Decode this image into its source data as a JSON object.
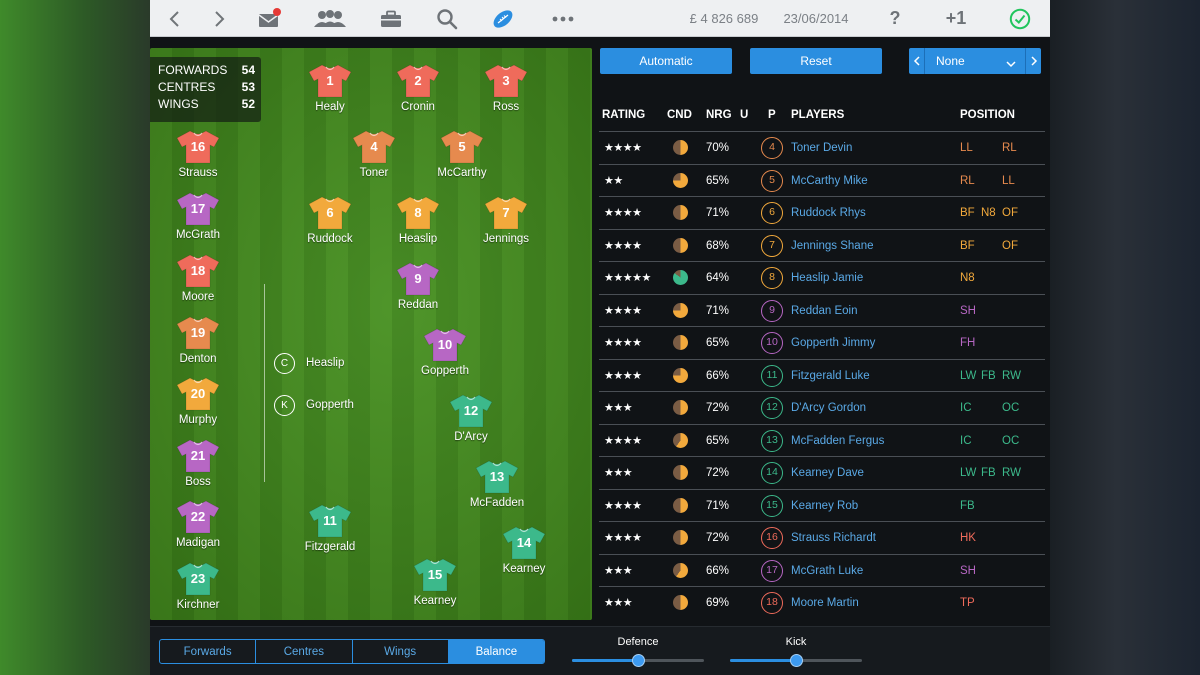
{
  "topbar": {
    "money": "£ 4 826 689",
    "date": "23/06/2014",
    "help_label": "?",
    "plus_label": "+1"
  },
  "pitch": {
    "unit_ratings": [
      {
        "label": "FORWARDS",
        "value": "54"
      },
      {
        "label": "CENTRES",
        "value": "53"
      },
      {
        "label": "WINGS",
        "value": "52"
      }
    ],
    "players": [
      {
        "num": "1",
        "name": "Healy",
        "color": "#ef6b5b"
      },
      {
        "num": "2",
        "name": "Cronin",
        "color": "#ef6b5b"
      },
      {
        "num": "3",
        "name": "Ross",
        "color": "#ef6b5b"
      },
      {
        "num": "4",
        "name": "Toner",
        "color": "#e68a4e"
      },
      {
        "num": "5",
        "name": "McCarthy",
        "color": "#e68a4e"
      },
      {
        "num": "6",
        "name": "Ruddock",
        "color": "#f2a93c"
      },
      {
        "num": "8",
        "name": "Heaslip",
        "color": "#f2a93c"
      },
      {
        "num": "7",
        "name": "Jennings",
        "color": "#f2a93c"
      },
      {
        "num": "9",
        "name": "Reddan",
        "color": "#b767c4"
      },
      {
        "num": "10",
        "name": "Gopperth",
        "color": "#b767c4"
      },
      {
        "num": "12",
        "name": "D'Arcy",
        "color": "#3cb98b"
      },
      {
        "num": "13",
        "name": "McFadden",
        "color": "#3cb98b"
      },
      {
        "num": "11",
        "name": "Fitzgerald",
        "color": "#3cb98b"
      },
      {
        "num": "14",
        "name": "Kearney",
        "color": "#3cb98b"
      },
      {
        "num": "15",
        "name": "Kearney",
        "color": "#3cb98b"
      }
    ],
    "bench": [
      {
        "num": "16",
        "name": "Strauss",
        "color": "#ef6b5b"
      },
      {
        "num": "17",
        "name": "McGrath",
        "color": "#b767c4"
      },
      {
        "num": "18",
        "name": "Moore",
        "color": "#ef6b5b"
      },
      {
        "num": "19",
        "name": "Denton",
        "color": "#e68a4e"
      },
      {
        "num": "20",
        "name": "Murphy",
        "color": "#f2a93c"
      },
      {
        "num": "21",
        "name": "Boss",
        "color": "#b767c4"
      },
      {
        "num": "22",
        "name": "Madigan",
        "color": "#b767c4"
      },
      {
        "num": "23",
        "name": "Kirchner",
        "color": "#3cb98b"
      }
    ],
    "roles": [
      {
        "letter": "C",
        "name": "Heaslip"
      },
      {
        "letter": "K",
        "name": "Gopperth"
      }
    ]
  },
  "controls": {
    "automatic_label": "Automatic",
    "reset_label": "Reset",
    "select_value": "None"
  },
  "table": {
    "headers": {
      "rating": "RATING",
      "cnd": "CND",
      "nrg": "NRG",
      "u": "U",
      "p": "P",
      "players": "PLAYERS",
      "position": "POSITION"
    },
    "rows": [
      {
        "stars": 4,
        "cnd": 0.5,
        "nrg": "70%",
        "num": "4",
        "num_color": "#e68a4e",
        "name": "Toner Devin",
        "positions": [
          {
            "p": "LL",
            "c": "#e68a4e"
          },
          {
            "p": "RL",
            "c": "#e68a4e"
          }
        ]
      },
      {
        "stars": 2,
        "cnd": 0.75,
        "nrg": "65%",
        "num": "5",
        "num_color": "#e68a4e",
        "name": "McCarthy Mike",
        "positions": [
          {
            "p": "RL",
            "c": "#e68a4e"
          },
          {
            "p": "LL",
            "c": "#e68a4e"
          }
        ]
      },
      {
        "stars": 4,
        "cnd": 0.5,
        "nrg": "71%",
        "num": "6",
        "num_color": "#f2a93c",
        "name": "Ruddock Rhys",
        "positions": [
          {
            "p": "BF",
            "c": "#f2a93c"
          },
          {
            "p": "N8",
            "c": "#f2a93c"
          },
          {
            "p": "OF",
            "c": "#f2a93c"
          }
        ]
      },
      {
        "stars": 4,
        "cnd": 0.5,
        "nrg": "68%",
        "num": "7",
        "num_color": "#f2a93c",
        "name": "Jennings Shane",
        "positions": [
          {
            "p": "BF",
            "c": "#f2a93c"
          },
          {
            "p": "OF",
            "c": "#f2a93c"
          }
        ]
      },
      {
        "stars": 5,
        "cnd": 0.85,
        "nrg": "64%",
        "num": "8",
        "num_color": "#f2a93c",
        "name": "Heaslip Jamie",
        "positions": [
          {
            "p": "N8",
            "c": "#f2a93c"
          }
        ]
      },
      {
        "stars": 4,
        "cnd": 0.75,
        "nrg": "71%",
        "num": "9",
        "num_color": "#b767c4",
        "name": "Reddan Eoin",
        "positions": [
          {
            "p": "SH",
            "c": "#b767c4"
          }
        ]
      },
      {
        "stars": 4,
        "cnd": 0.5,
        "nrg": "65%",
        "num": "10",
        "num_color": "#b767c4",
        "name": "Gopperth Jimmy",
        "positions": [
          {
            "p": "FH",
            "c": "#b767c4"
          }
        ]
      },
      {
        "stars": 4,
        "cnd": 0.75,
        "nrg": "66%",
        "num": "11",
        "num_color": "#3cb98b",
        "name": "Fitzgerald Luke",
        "positions": [
          {
            "p": "LW",
            "c": "#3cb98b"
          },
          {
            "p": "FB",
            "c": "#3cb98b"
          },
          {
            "p": "RW",
            "c": "#3cb98b"
          }
        ]
      },
      {
        "stars": 3,
        "cnd": 0.5,
        "nrg": "72%",
        "num": "12",
        "num_color": "#3cb98b",
        "name": "D'Arcy Gordon",
        "positions": [
          {
            "p": "IC",
            "c": "#3cb98b"
          },
          {
            "p": "OC",
            "c": "#3cb98b"
          }
        ]
      },
      {
        "stars": 4,
        "cnd": 0.6,
        "nrg": "65%",
        "num": "13",
        "num_color": "#3cb98b",
        "name": "McFadden Fergus",
        "positions": [
          {
            "p": "IC",
            "c": "#3cb98b"
          },
          {
            "p": "OC",
            "c": "#3cb98b"
          }
        ]
      },
      {
        "stars": 3,
        "cnd": 0.5,
        "nrg": "72%",
        "num": "14",
        "num_color": "#3cb98b",
        "name": "Kearney Dave",
        "positions": [
          {
            "p": "LW",
            "c": "#3cb98b"
          },
          {
            "p": "FB",
            "c": "#3cb98b"
          },
          {
            "p": "RW",
            "c": "#3cb98b"
          }
        ]
      },
      {
        "stars": 4,
        "cnd": 0.5,
        "nrg": "71%",
        "num": "15",
        "num_color": "#3cb98b",
        "name": "Kearney Rob",
        "positions": [
          {
            "p": "FB",
            "c": "#3cb98b"
          }
        ]
      },
      {
        "stars": 4,
        "cnd": 0.5,
        "nrg": "72%",
        "num": "16",
        "num_color": "#ef6b5b",
        "name": "Strauss Richardt",
        "positions": [
          {
            "p": "HK",
            "c": "#ef6b5b"
          }
        ]
      },
      {
        "stars": 3,
        "cnd": 0.6,
        "nrg": "66%",
        "num": "17",
        "num_color": "#b767c4",
        "name": "McGrath Luke",
        "positions": [
          {
            "p": "SH",
            "c": "#b767c4"
          }
        ]
      },
      {
        "stars": 3,
        "cnd": 0.5,
        "nrg": "69%",
        "num": "18",
        "num_color": "#ef6b5b",
        "name": "Moore Martin",
        "positions": [
          {
            "p": "TP",
            "c": "#ef6b5b"
          }
        ]
      }
    ]
  },
  "bottom": {
    "tabs": [
      {
        "label": "Forwards",
        "active": false
      },
      {
        "label": "Centres",
        "active": false
      },
      {
        "label": "Wings",
        "active": false
      },
      {
        "label": "Balance",
        "active": true
      }
    ],
    "sliders": [
      {
        "label": "Defence",
        "value": 0.5
      },
      {
        "label": "Kick",
        "value": 0.5
      }
    ]
  },
  "colors": {
    "accent": "#2b8ee0",
    "link": "#5aa9e6",
    "success": "#22c55e",
    "notification": "#e53935"
  },
  "icons": [
    "back-icon",
    "forward-icon",
    "mail-icon",
    "squad-icon",
    "briefcase-icon",
    "search-icon",
    "rugby-ball-icon",
    "more-icon",
    "confirm-check-icon"
  ]
}
